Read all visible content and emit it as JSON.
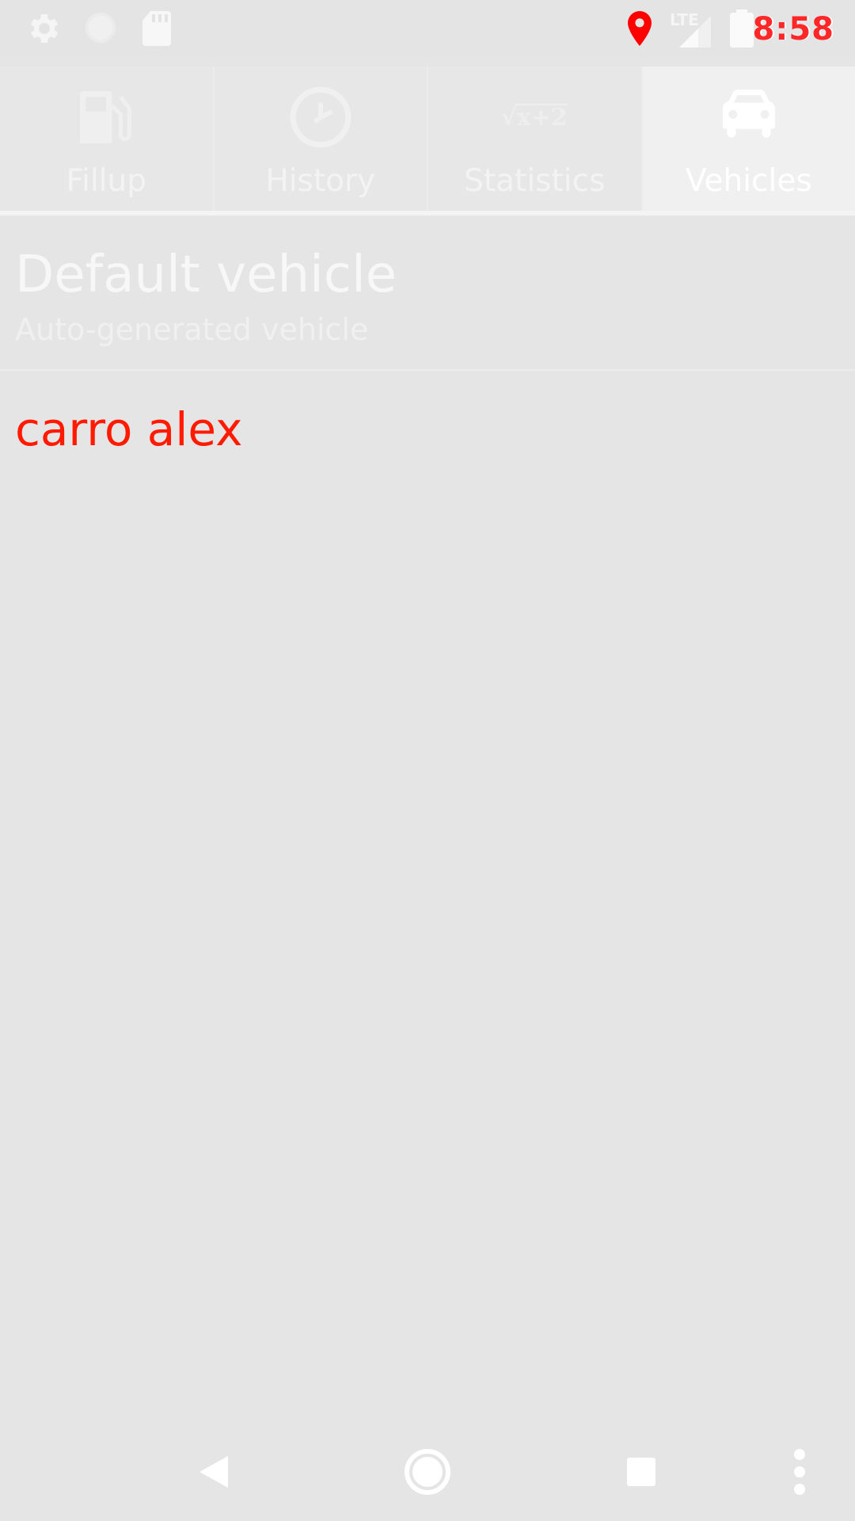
{
  "status_bar": {
    "time": "8:58",
    "time_overlay": "8:58",
    "network_label": "LTE",
    "icons": [
      "gear-icon",
      "circle-icon",
      "sd-card-icon",
      "location-pin-icon",
      "signal-icon",
      "battery-icon"
    ],
    "location_color": "#ff0000"
  },
  "tabs": [
    {
      "label": "Fillup",
      "icon": "fuel-pump-icon",
      "active": false
    },
    {
      "label": "History",
      "icon": "clock-icon",
      "active": false
    },
    {
      "label": "Statistics",
      "icon": "formula-icon",
      "formula_text": "√x+2",
      "active": false
    },
    {
      "label": "Vehicles",
      "icon": "car-icon",
      "active": true
    }
  ],
  "vehicles": [
    {
      "name": "Default vehicle",
      "description": "Auto-generated vehicle"
    },
    {
      "name": "carro alex",
      "description": "",
      "color": "#ff1a00"
    }
  ],
  "nav_bar": {
    "buttons": [
      "back-icon",
      "home-icon",
      "recents-icon",
      "overflow-menu-icon"
    ]
  },
  "colors": {
    "background": "#e5e5e5",
    "accent_red": "#ff1a00"
  }
}
